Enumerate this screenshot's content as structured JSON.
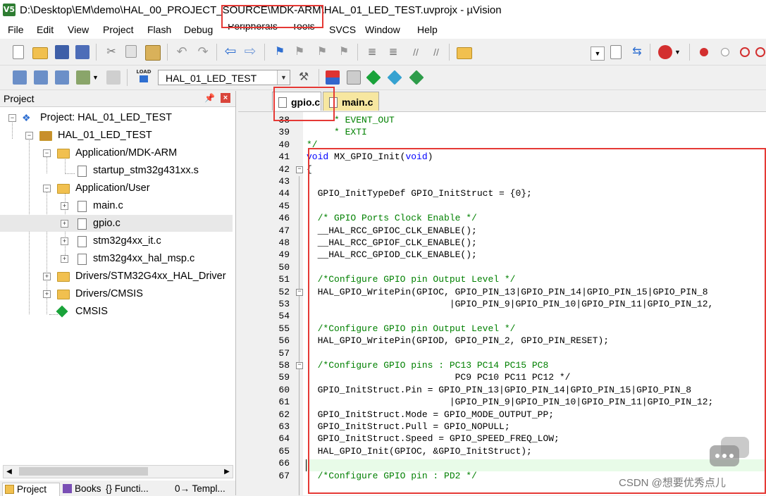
{
  "window": {
    "title": "D:\\Desktop\\EM\\demo\\HAL_00_PROJECT_SOURCE\\MDK-ARM\\HAL_01_LED_TEST.uvprojx - µVision",
    "icon_text": "V5"
  },
  "menu": [
    "File",
    "Edit",
    "View",
    "Project",
    "Flash",
    "Debug",
    "Peripherals",
    "Tools",
    "SVCS",
    "Window",
    "Help"
  ],
  "toolbar": {
    "target": "HAL_01_LED_TEST",
    "load_label": "LOAD"
  },
  "project_panel": {
    "title": "Project",
    "tree": [
      {
        "label": "Project: HAL_01_LED_TEST"
      },
      {
        "label": "HAL_01_LED_TEST"
      },
      {
        "label": "Application/MDK-ARM"
      },
      {
        "label": "startup_stm32g431xx.s"
      },
      {
        "label": "Application/User"
      },
      {
        "label": "main.c"
      },
      {
        "label": "gpio.c"
      },
      {
        "label": "stm32g4xx_it.c"
      },
      {
        "label": "stm32g4xx_hal_msp.c"
      },
      {
        "label": "Drivers/STM32G4xx_HAL_Driver"
      },
      {
        "label": "Drivers/CMSIS"
      },
      {
        "label": "CMSIS"
      }
    ],
    "bottom_tabs": [
      "Project",
      "Books",
      "{} Functi...",
      "0→ Templ..."
    ]
  },
  "editor": {
    "tabs": [
      "gpio.c",
      "main.c"
    ],
    "active_tab": "gpio.c",
    "lines": [
      {
        "n": "38",
        "text": "     * EVENT_OUT"
      },
      {
        "n": "39",
        "text": "     * EXTI"
      },
      {
        "n": "40",
        "text": "*/"
      },
      {
        "n": "41",
        "text": "void MX_GPIO_Init(void)"
      },
      {
        "n": "42",
        "text": "{"
      },
      {
        "n": "43",
        "text": ""
      },
      {
        "n": "44",
        "text": "  GPIO_InitTypeDef GPIO_InitStruct = {0};"
      },
      {
        "n": "45",
        "text": ""
      },
      {
        "n": "46",
        "text": "  /* GPIO Ports Clock Enable */"
      },
      {
        "n": "47",
        "text": "  __HAL_RCC_GPIOC_CLK_ENABLE();"
      },
      {
        "n": "48",
        "text": "  __HAL_RCC_GPIOF_CLK_ENABLE();"
      },
      {
        "n": "49",
        "text": "  __HAL_RCC_GPIOD_CLK_ENABLE();"
      },
      {
        "n": "50",
        "text": ""
      },
      {
        "n": "51",
        "text": "  /*Configure GPIO pin Output Level */"
      },
      {
        "n": "52",
        "text": "  HAL_GPIO_WritePin(GPIOC, GPIO_PIN_13|GPIO_PIN_14|GPIO_PIN_15|GPIO_PIN_8"
      },
      {
        "n": "53",
        "text": "                          |GPIO_PIN_9|GPIO_PIN_10|GPIO_PIN_11|GPIO_PIN_12,"
      },
      {
        "n": "54",
        "text": ""
      },
      {
        "n": "55",
        "text": "  /*Configure GPIO pin Output Level */"
      },
      {
        "n": "56",
        "text": "  HAL_GPIO_WritePin(GPIOD, GPIO_PIN_2, GPIO_PIN_RESET);"
      },
      {
        "n": "57",
        "text": ""
      },
      {
        "n": "58",
        "text": "  /*Configure GPIO pins : PC13 PC14 PC15 PC8"
      },
      {
        "n": "59",
        "text": "                           PC9 PC10 PC11 PC12 */"
      },
      {
        "n": "60",
        "text": "  GPIO_InitStruct.Pin = GPIO_PIN_13|GPIO_PIN_14|GPIO_PIN_15|GPIO_PIN_8"
      },
      {
        "n": "61",
        "text": "                          |GPIO_PIN_9|GPIO_PIN_10|GPIO_PIN_11|GPIO_PIN_12;"
      },
      {
        "n": "62",
        "text": "  GPIO_InitStruct.Mode = GPIO_MODE_OUTPUT_PP;"
      },
      {
        "n": "63",
        "text": "  GPIO_InitStruct.Pull = GPIO_NOPULL;"
      },
      {
        "n": "64",
        "text": "  GPIO_InitStruct.Speed = GPIO_SPEED_FREQ_LOW;"
      },
      {
        "n": "65",
        "text": "  HAL_GPIO_Init(GPIOC, &GPIO_InitStruct);"
      },
      {
        "n": "66",
        "text": ""
      },
      {
        "n": "67",
        "text": "  /*Configure GPIO pin : PD2 */"
      }
    ]
  },
  "watermark": "CSDN @想要优秀点儿",
  "colors": {
    "comment": "#008000",
    "keyword": "#0000ff",
    "annotation": "#e53935",
    "current_line": "#e8fbe8"
  }
}
